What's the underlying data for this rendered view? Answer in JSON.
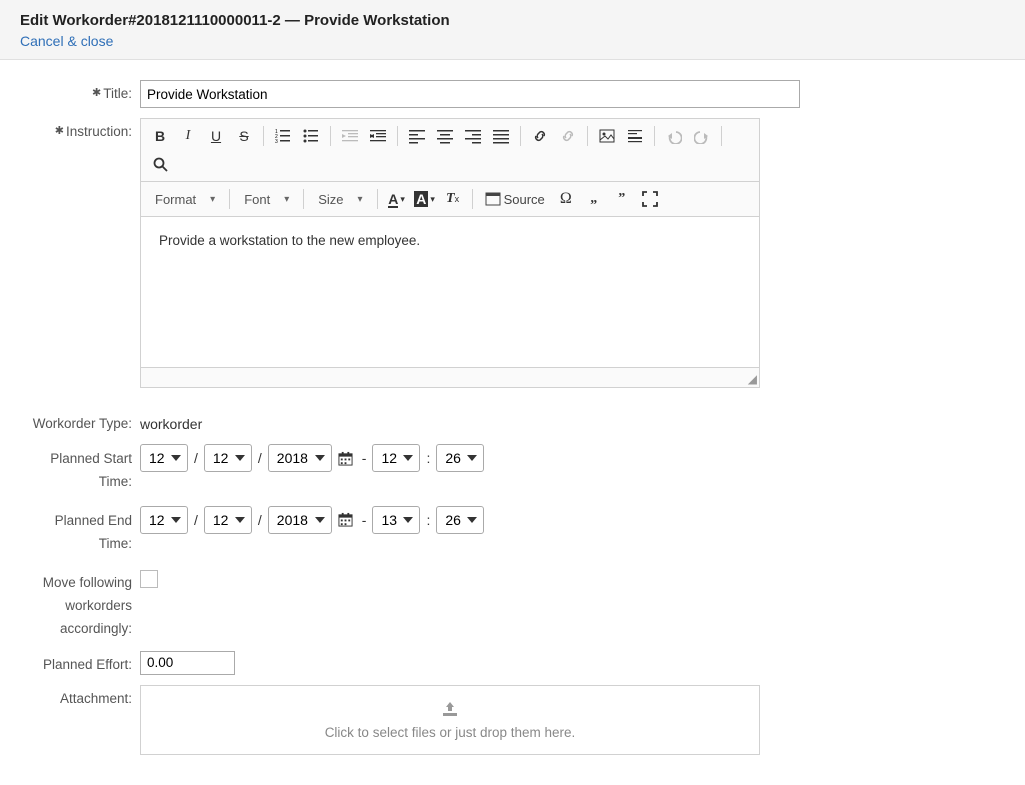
{
  "header": {
    "title": "Edit Workorder#2018121110000011-2 — Provide Workstation",
    "cancel": "Cancel & close"
  },
  "fields": {
    "title_label": "Title:",
    "title_value": "Provide Workstation",
    "instruction_label": "Instruction:",
    "instruction_value": "Provide a workstation to the new employee.",
    "workorder_type_label": "Workorder Type:",
    "workorder_type_value": "workorder",
    "planned_start_label": "Planned Start Time:",
    "planned_end_label": "Planned End Time:",
    "move_label": "Move following workorders accordingly:",
    "planned_effort_label": "Planned Effort:",
    "planned_effort_value": "0.00",
    "attachment_label": "Attachment:",
    "dropzone_text": "Click to select files or just drop them here."
  },
  "editor": {
    "combos": {
      "format": "Format",
      "font": "Font",
      "size": "Size"
    },
    "source": "Source"
  },
  "dates": {
    "start": {
      "month": "12",
      "day": "12",
      "year": "2018",
      "hour": "12",
      "minute": "26"
    },
    "end": {
      "month": "12",
      "day": "12",
      "year": "2018",
      "hour": "13",
      "minute": "26"
    }
  }
}
